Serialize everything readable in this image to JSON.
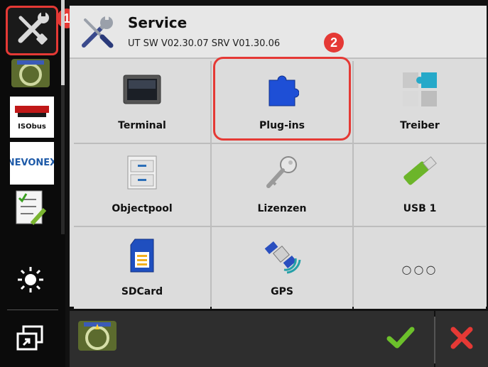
{
  "header": {
    "title": "Service",
    "subtitle": "UT SW V02.30.07 SRV V01.30.06",
    "icon": "wrench-screwdriver-icon"
  },
  "annotations": {
    "badge_1": "1",
    "badge_2": "2",
    "color": "#e53935"
  },
  "sidebar": {
    "items": [
      {
        "name": "service-tools",
        "icon": "wrench-screwdriver-icon",
        "selected": true
      },
      {
        "name": "steering-wheel",
        "icon": "steering-wheel-icon"
      },
      {
        "name": "isobus",
        "icon": "isobus-logo",
        "text": "ISObus"
      },
      {
        "name": "nevonex",
        "icon": "nevonex-logo",
        "text": "NEVONEX"
      },
      {
        "name": "checklist",
        "icon": "checklist-icon"
      },
      {
        "name": "brightness",
        "icon": "brightness-icon"
      },
      {
        "name": "window-switch",
        "icon": "window-switch-icon"
      }
    ]
  },
  "tiles": [
    {
      "label": "Terminal",
      "icon": "terminal-icon"
    },
    {
      "label": "Plug-ins",
      "icon": "puzzle-piece-icon"
    },
    {
      "label": "Treiber",
      "icon": "puzzle-multi-icon"
    },
    {
      "label": "Objectpool",
      "icon": "file-cabinet-icon"
    },
    {
      "label": "Lizenzen",
      "icon": "key-icon"
    },
    {
      "label": "USB 1",
      "icon": "usb-stick-icon"
    },
    {
      "label": "SDCard",
      "icon": "sd-card-icon"
    },
    {
      "label": "GPS",
      "icon": "satellite-icon"
    },
    {
      "label": "",
      "icon": "more-icon",
      "dots": "○○○"
    }
  ],
  "bottom": {
    "app_icon": "steering-wheel-icon",
    "ok_icon": "check-icon",
    "cancel_icon": "close-icon",
    "ok_color": "#6cc02b",
    "cancel_color": "#e53935"
  }
}
